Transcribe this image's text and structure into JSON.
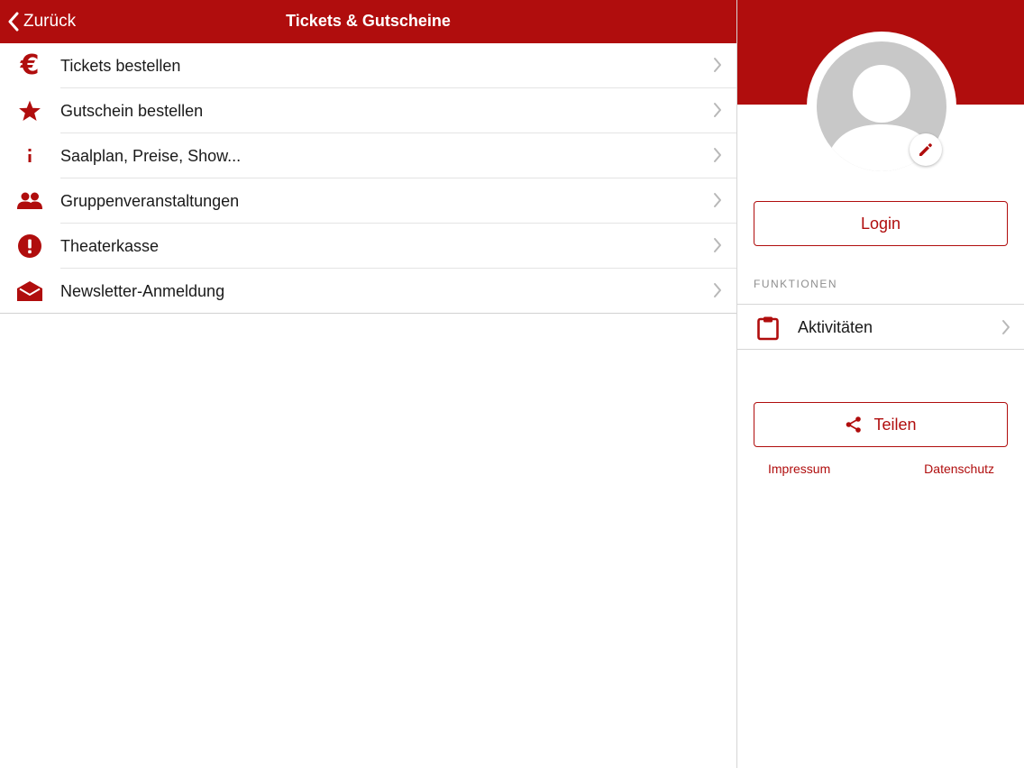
{
  "navbar": {
    "back_label": "Zurück",
    "title": "Tickets & Gutscheine"
  },
  "menu": {
    "items": [
      {
        "label": "Tickets bestellen",
        "icon": "euro-icon"
      },
      {
        "label": "Gutschein bestellen",
        "icon": "star-icon"
      },
      {
        "label": "Saalplan, Preise, Show...",
        "icon": "info-icon"
      },
      {
        "label": "Gruppenveranstaltungen",
        "icon": "group-icon"
      },
      {
        "label": "Theaterkasse",
        "icon": "alert-icon"
      },
      {
        "label": "Newsletter-Anmeldung",
        "icon": "envelope-icon"
      }
    ]
  },
  "profile": {
    "login_label": "Login",
    "section_label": "FUNKTIONEN",
    "functions": [
      {
        "label": "Aktivitäten",
        "icon": "clipboard-icon"
      }
    ],
    "share_label": "Teilen",
    "links": {
      "impressum": "Impressum",
      "datenschutz": "Datenschutz"
    }
  },
  "colors": {
    "accent": "#b00d0d",
    "separator": "#e4e4e4",
    "avatar_gray": "#c8c8c8"
  }
}
